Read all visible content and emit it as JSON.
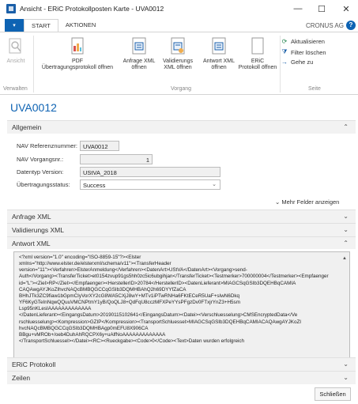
{
  "window": {
    "title": "Ansicht - ERiC Protokollposten Karte - UVA0012",
    "minimize": "—",
    "maximize": "☐",
    "close": "✕"
  },
  "ribbon": {
    "menu": "▾",
    "tabs": [
      "START",
      "AKTIONEN"
    ],
    "company": "CRONUS AG",
    "help": "?",
    "buttons": {
      "view": "Ansicht",
      "pdf": "PDF\nÜbertragungsprotokoll öffnen",
      "request_xml": "Anfrage XML\nöffnen",
      "validation_xml": "Validierungs\nXML öffnen",
      "response_xml": "Antwort XML\nöffnen",
      "eric_log": "ERiC\nProtokoll öffnen",
      "refresh": "Aktualisieren",
      "clear_filter": "Filter löschen",
      "goto": "Gehe zu"
    },
    "groups": {
      "manage": "Verwalten",
      "process": "Vorgang",
      "page": "Seite"
    }
  },
  "page": {
    "title": "UVA0012",
    "more_fields": "Mehr Felder anzeigen",
    "close_button": "Schließen"
  },
  "general": {
    "header": "Allgemein",
    "fields": [
      {
        "label": "NAV Referenznummer:",
        "value": "UVA0012"
      },
      {
        "label": "NAV Vorgangsnr.:",
        "value": "1"
      },
      {
        "label": "Datentyp Version:",
        "value": "UStVA_2018"
      },
      {
        "label": "Übertragungsstatus:",
        "value": "Success"
      }
    ]
  },
  "sections": {
    "request_xml": "Anfrage XML",
    "validation_xml": "Validierungs XML",
    "response_xml": "Antwort XML",
    "eric_log": "ERiC Protokoll",
    "lines": "Zeilen"
  },
  "response_xml_content": "<?xml version=\"1.0\" encoding=\"ISO-8859-15\"?><Elster\nxmlns=\"http://www.elster.de/elsterxml/schema/v11\"><TransferHeader\nversion=\"11\"><Verfahren>ElsterAnmeldung</Verfahren><DatenArt>UStVA</DatenArt><Vorgang>send-\nAuth</Vorgang><TransferTicket>et0154zvup91gs5hh0zc5ic6ubgihjan</TransferTicket><Testmerker>700000004</Testmerker><Empfaenger\nid=\"L\"><Ziel>RP</Ziel></Empfaenger><HerstellerID>20784</HerstellerID><DatenLieferant>MIAGCSqGSIb3DQEHBqCAMIA\nCAQAwgAYJKoZIhvcNAQcBMBQGCCqGSIb3DQMHBAhQ2h69DYYfZaCA\nBHhJTk3ZC9fiaw1bGpmCIyVorXY2cG8WA5CXjJ8wY+MTv1iPTwRNHa6FKtECeR5UaF+sIwN6Dkq\nYF6KyGTeInNqwQQuuVMCNPtmY1yB/QoQLJ8+QdFqU8cczMFXPeYYsPFgzDv0FTxjrYnZ3+H5sm\nLsp95nKLesIAAAAAAAAAAAAA\n</DatenLieferant><EingangsDatum>20190115102641</EingangsDatum><Datei><Verschluesselung>CMSEncryptedData</Ve\nrschluesselung><Kompression>GZIP</Kompression><TransportSchluessel>MIAGCSqGSIb3DQEHBqCAMIACAQAwgAYJKoZI\nhvcNAQcBMBQGCCqGSIb3DQMHBAgp0mEFU8X906CA\nBBgu+vMROb+/oeb4DuhAhRQCPX6y+uAlfNoAAAAAAAAAAAAA\n</TransportSchluessel></Datei><RC><Rueckgabe><Code>0</Code><Text>Daten wurden erfolgreich"
}
